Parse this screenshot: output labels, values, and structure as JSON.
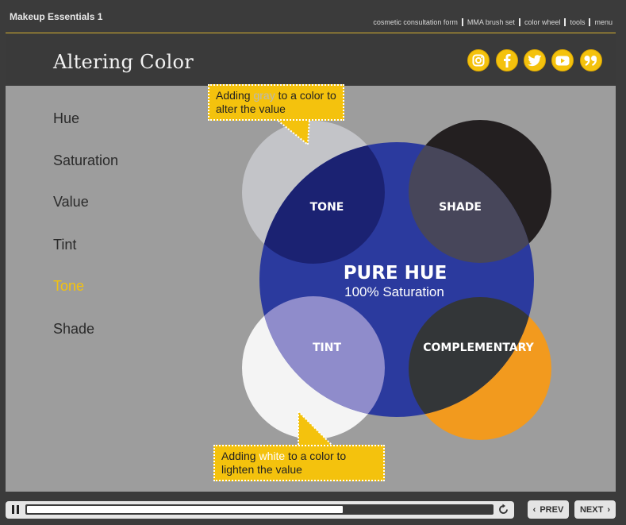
{
  "course_title": "Makeup Essentials 1",
  "top_nav": [
    "cosmetic consultation form",
    "MMA brush set",
    "color wheel",
    "tools",
    "menu"
  ],
  "page_title": "Altering Color",
  "social_icons": [
    "instagram-icon",
    "facebook-icon",
    "twitter-icon",
    "youtube-icon",
    "quote-icon"
  ],
  "menu_items": [
    "Hue",
    "Saturation",
    "Value",
    "Tint",
    "Tone",
    "Shade"
  ],
  "active_menu_item": "Tone",
  "diagram": {
    "pure_hue": "PURE HUE",
    "saturation": "100% Saturation",
    "tone": "TONE",
    "shade": "SHADE",
    "tint": "TINT",
    "complementary": "COMPLEMENTARY"
  },
  "callout_gray": {
    "before": "Adding ",
    "highlight": "gray",
    "after": " to a color to alter the value"
  },
  "callout_white": {
    "before": "Adding ",
    "highlight": "white",
    "after": " to a color to lighten the value"
  },
  "player": {
    "progress": 0.68,
    "prev_label": "PREV",
    "next_label": "NEXT"
  },
  "colors": {
    "accent": "#f4c20d",
    "pure_hue": "#2b3a9e",
    "complementary": "#f29a1e",
    "shade": "#231f20"
  }
}
